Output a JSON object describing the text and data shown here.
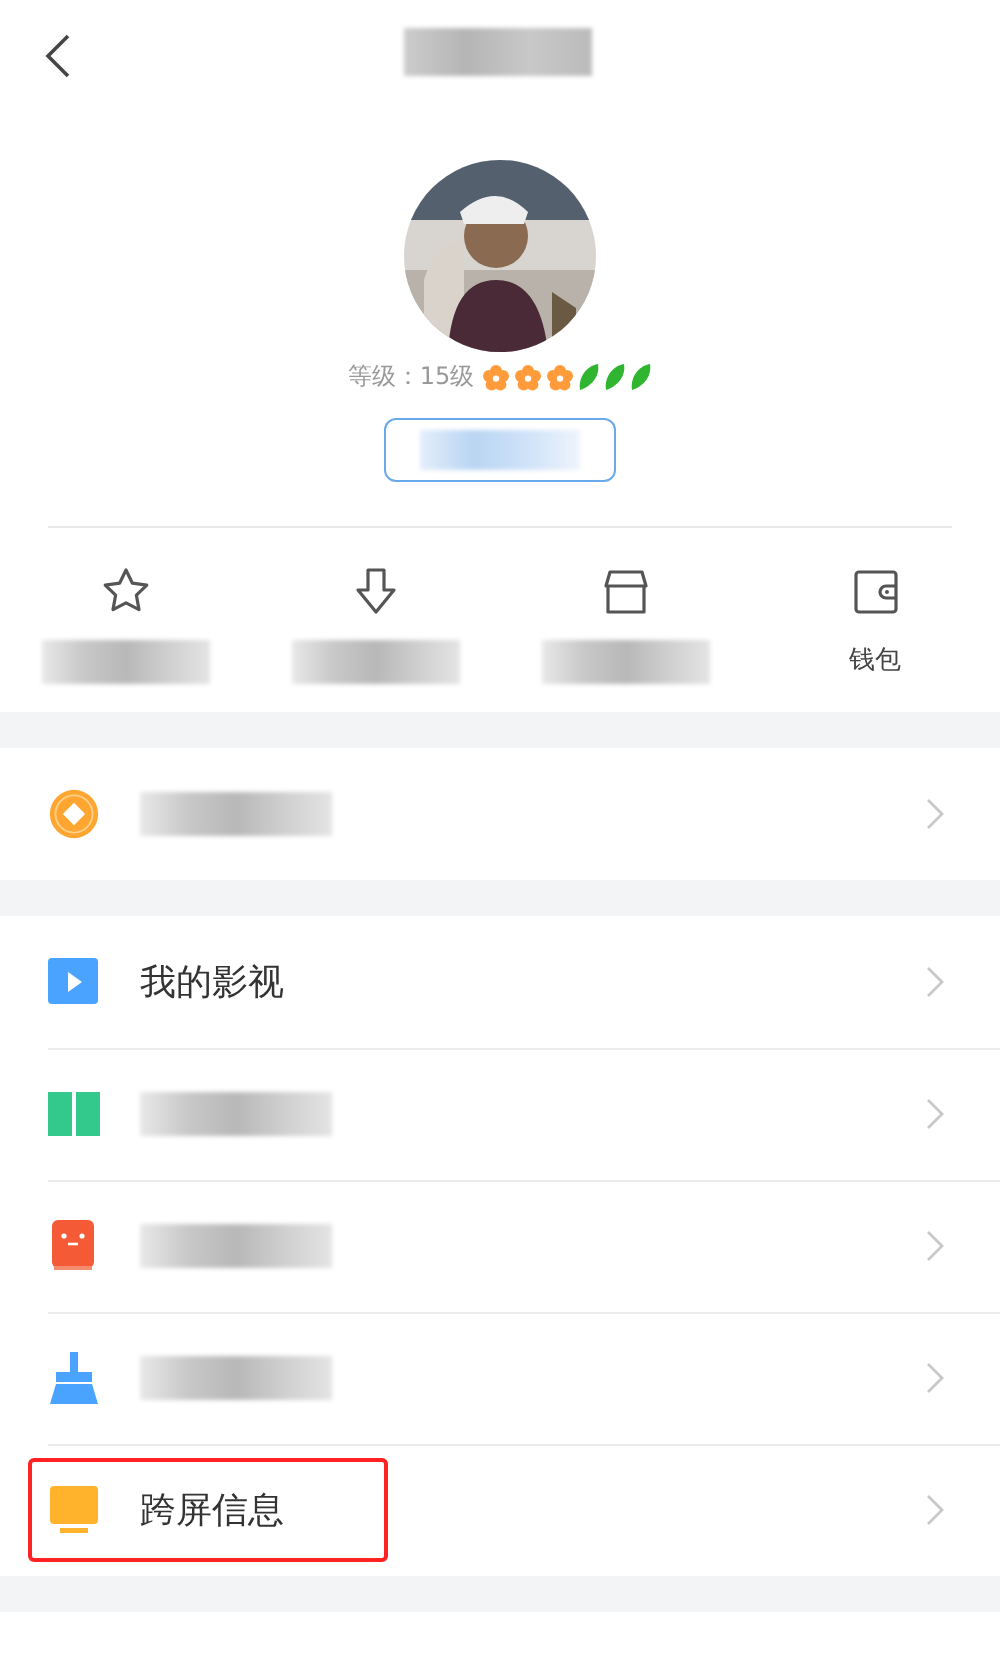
{
  "profile": {
    "level_text": "等级：15级",
    "badges": [
      {
        "kind": "flower"
      },
      {
        "kind": "flower"
      },
      {
        "kind": "flower"
      },
      {
        "kind": "leaf"
      },
      {
        "kind": "leaf"
      },
      {
        "kind": "leaf"
      }
    ]
  },
  "shortcuts": [
    {
      "kind": "blurred"
    },
    {
      "kind": "blurred"
    },
    {
      "kind": "blurred"
    },
    {
      "kind": "text",
      "label": "钱包"
    }
  ],
  "vip_row": {
    "kind": "blurred"
  },
  "menu": [
    {
      "kind": "text",
      "label": "我的影视",
      "highlighted": false
    },
    {
      "kind": "blurred",
      "highlighted": false
    },
    {
      "kind": "blurred",
      "highlighted": false
    },
    {
      "kind": "blurred",
      "highlighted": false
    },
    {
      "kind": "text",
      "label": "跨屏信息",
      "highlighted": true
    }
  ]
}
